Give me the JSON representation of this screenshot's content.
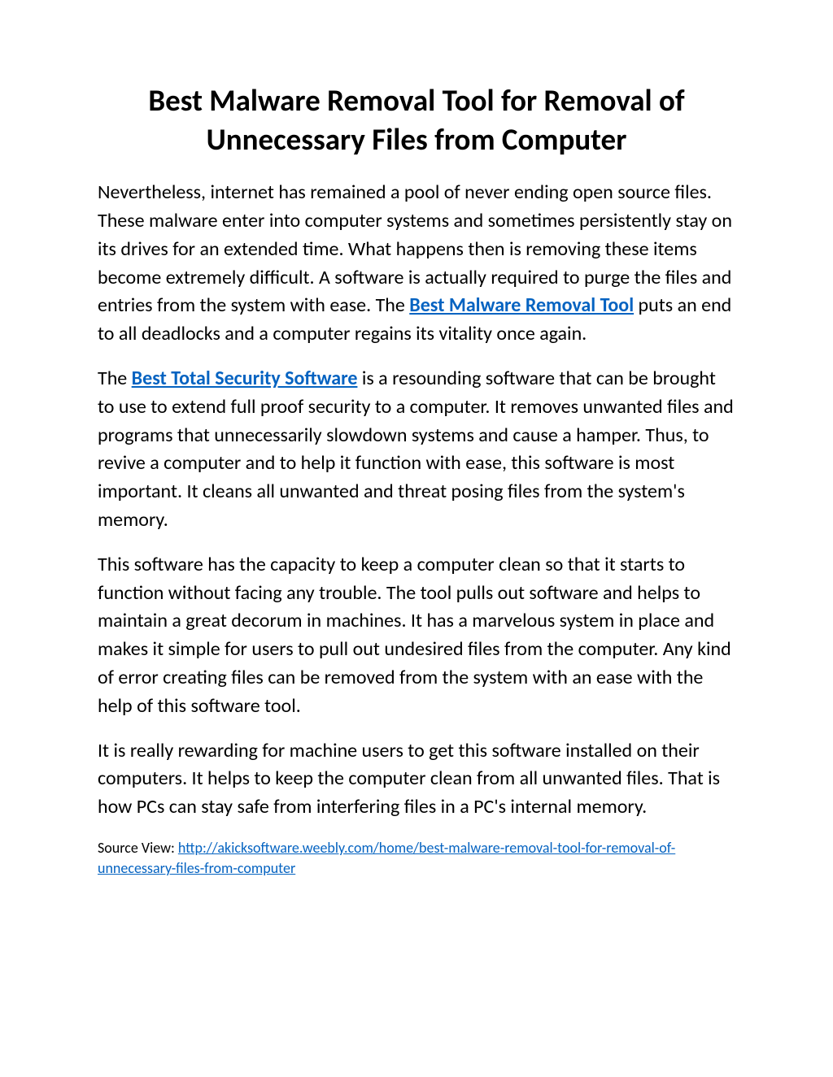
{
  "title": "Best Malware Removal Tool for Removal of Unnecessary Files from Computer",
  "para1_part1": "Nevertheless, internet has remained a pool of never ending open source files. These malware enter into computer systems and sometimes persistently stay on its drives for an extended time. What happens then is removing these items become extremely difficult. A software is actually required to purge the files and entries from the system with ease. The ",
  "para1_link": "Best Malware Removal Tool",
  "para1_part2": " puts an end to all deadlocks and a computer regains its vitality once again.",
  "para2_part1": "The ",
  "para2_link": "Best Total Security Software",
  "para2_part2": " is a resounding software that can be brought to use to extend full proof security to a computer. It removes unwanted files and programs that unnecessarily slowdown systems and cause a hamper. Thus, to revive a computer and to help it function with ease, this software is most important. It cleans all unwanted and threat posing files from the system's memory.",
  "para3": "This software has the capacity to keep a computer clean so that it starts to function without facing any trouble. The tool pulls out software and helps to maintain a great decorum in machines. It has a marvelous system in place and makes it simple for users to pull out undesired files from the computer. Any kind of error creating files can be removed from the system with an ease with the help of this software tool.",
  "para4": "It is really rewarding for machine users to get this software installed on their computers. It helps to keep the computer clean from all unwanted files. That is how PCs can stay safe from interfering files in a PC's internal memory.",
  "source_label": "Source View: ",
  "source_url": "http://akicksoftware.weebly.com/home/best-malware-removal-tool-for-removal-of-unnecessary-files-from-computer"
}
